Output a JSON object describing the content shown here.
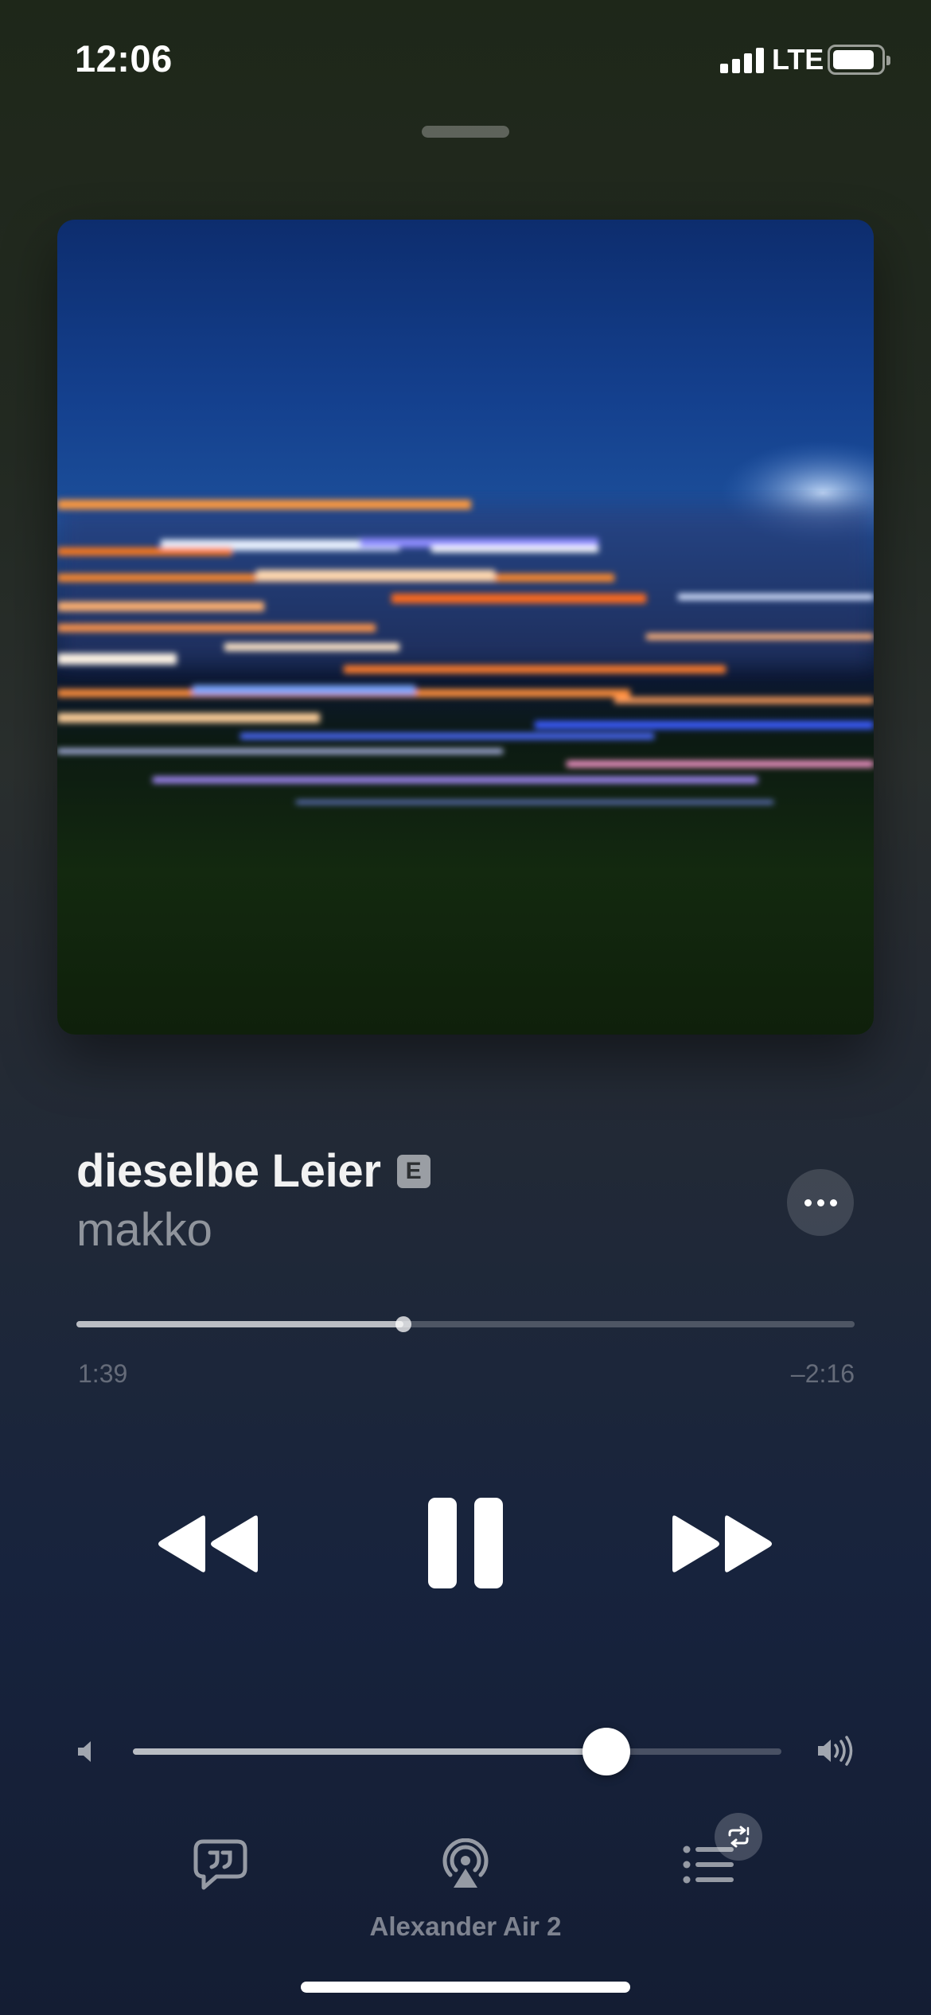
{
  "status_bar": {
    "time": "12:06",
    "network": "LTE",
    "signal_bars": 4,
    "battery_level": 0.88
  },
  "artwork": {
    "description_icon": "album-artwork"
  },
  "track": {
    "title": "dieselbe Leier",
    "explicit_badge": "E",
    "artist": "makko"
  },
  "playback": {
    "elapsed": "1:39",
    "remaining": "–2:16",
    "progress": 0.42,
    "state": "playing"
  },
  "controls": {
    "rewind_icon": "backward-icon",
    "pause_icon": "pause-icon",
    "forward_icon": "forward-icon",
    "more_icon": "ellipsis-icon"
  },
  "volume": {
    "level": 0.73
  },
  "bottom_bar": {
    "lyrics_icon": "lyrics-quote-bubble-icon",
    "airplay_icon": "airplay-audio-icon",
    "device_name": "Alexander Air 2",
    "queue_icon": "queue-list-icon",
    "repeat_icon": "repeat-one-icon"
  },
  "colors": {
    "background_top": "#1e2719",
    "background_bottom": "#141d33",
    "foreground": "#ffffff"
  }
}
